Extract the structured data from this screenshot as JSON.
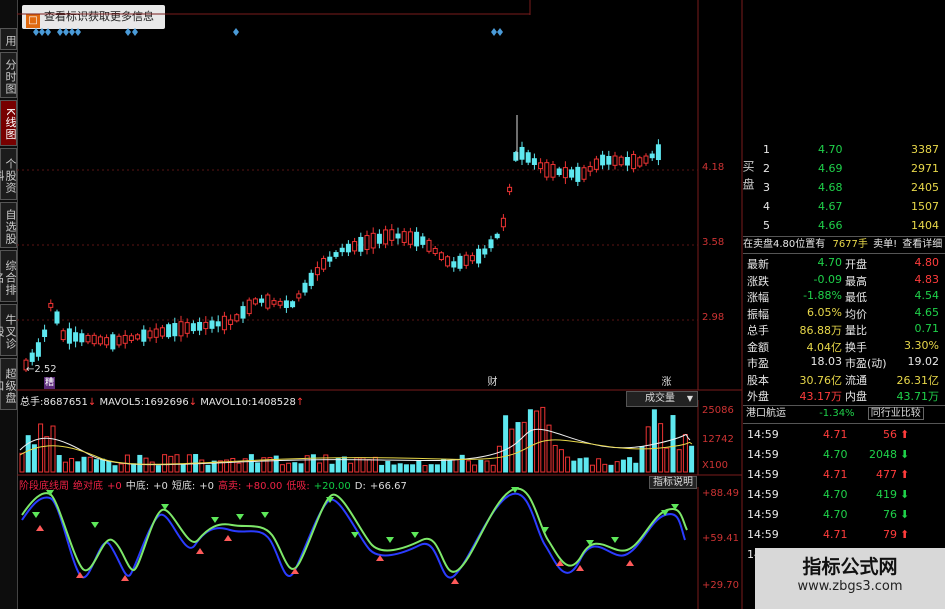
{
  "notice": {
    "icon": "window-icon",
    "text": "查看标识获取更多信息"
  },
  "sidebar": {
    "tabs": [
      "用",
      "分时图",
      "K线图",
      "个股资料",
      "自选股",
      "综合排名",
      "牛叉诊股",
      "超级盘口"
    ],
    "active": 2
  },
  "price_axis": {
    "labels": [
      "4.18",
      "3.58",
      "2.98"
    ],
    "low_marker": "2.52"
  },
  "markers": {
    "m1": "糟",
    "m2": "财",
    "m3": "涨"
  },
  "volume": {
    "header": {
      "total_label": "总手:",
      "total_value": "8687651",
      "mavol5_label": "MAVOL5:",
      "mavol5_value": "1692696",
      "mavol10_label": "MAVOL10:",
      "mavol10_value": "1408528"
    },
    "selector": "成交量",
    "axis": [
      "25086",
      "12742",
      "X100"
    ]
  },
  "indicator": {
    "header": [
      {
        "t": "阶段底线周",
        "c": "#e24"
      },
      {
        "t": "绝对底",
        "c": "#e24"
      },
      {
        "t": "+0",
        "c": "#e24"
      },
      {
        "t": "中底:",
        "c": "#ddd"
      },
      {
        "t": "+0",
        "c": "#ddd"
      },
      {
        "t": "短底:",
        "c": "#ddd"
      },
      {
        "t": "+0",
        "c": "#ddd"
      },
      {
        "t": "高卖:",
        "c": "#e24"
      },
      {
        "t": "+80.00",
        "c": "#e24"
      },
      {
        "t": "低吸:",
        "c": "#e24"
      },
      {
        "t": "+20.00",
        "c": "#1c4"
      },
      {
        "t": "D:",
        "c": "#ddd"
      },
      {
        "t": "+66.67",
        "c": "#ddd"
      }
    ],
    "button": "指标说明",
    "axis": [
      "+88.49",
      "+59.41",
      "+29.70"
    ]
  },
  "order_book": {
    "buy_label": "买盘",
    "rows": [
      {
        "lvl": "1",
        "price": "4.70",
        "vol": "3387"
      },
      {
        "lvl": "2",
        "price": "4.69",
        "vol": "2971"
      },
      {
        "lvl": "3",
        "price": "4.68",
        "vol": "2405"
      },
      {
        "lvl": "4",
        "price": "4.67",
        "vol": "1507"
      },
      {
        "lvl": "5",
        "price": "4.66",
        "vol": "1404"
      }
    ]
  },
  "sell_bar": {
    "text": "在卖盘4.80位置有",
    "vol": "7677手",
    "sell1": "卖单!",
    "detail": "查看详细"
  },
  "quote": [
    {
      "l": "最新",
      "v": "4.70",
      "vc": "green",
      "l2": "开盘",
      "v2": "4.80",
      "v2c": "red"
    },
    {
      "l": "涨跌",
      "v": "-0.09",
      "vc": "green",
      "l2": "最高",
      "v2": "4.83",
      "v2c": "red"
    },
    {
      "l": "涨幅",
      "v": "-1.88%",
      "vc": "green",
      "l2": "最低",
      "v2": "4.54",
      "v2c": "green"
    },
    {
      "l": "振幅",
      "v": "6.05%",
      "vc": "yellow",
      "l2": "均价",
      "v2": "4.65",
      "v2c": "green"
    },
    {
      "l": "总手",
      "v": "86.88万",
      "vc": "yellow",
      "l2": "量比",
      "v2": "0.71",
      "v2c": "green"
    },
    {
      "l": "金额",
      "v": "4.04亿",
      "vc": "yellow",
      "l2": "换手",
      "v2": "3.30%",
      "v2c": "yellow"
    },
    {
      "l": "市盈",
      "v": "18.03",
      "vc": "white",
      "l2": "市盈(动)",
      "v2": "19.02",
      "v2c": "white"
    },
    {
      "l": "股本",
      "v": "30.76亿",
      "vc": "yellow",
      "l2": "流通",
      "v2": "26.31亿",
      "v2c": "yellow"
    },
    {
      "l": "外盘",
      "v": "43.17万",
      "vc": "red",
      "l2": "内盘",
      "v2": "43.71万",
      "v2c": "green"
    }
  ],
  "sector": {
    "name": "港口航运",
    "change": "-1.34%",
    "compare": "同行业比较"
  },
  "ticks": [
    {
      "time": "14:59",
      "price": "4.71",
      "vol": "56",
      "dir": "up"
    },
    {
      "time": "14:59",
      "price": "4.70",
      "vol": "2048",
      "dir": "down"
    },
    {
      "time": "14:59",
      "price": "4.71",
      "vol": "477",
      "dir": "up"
    },
    {
      "time": "14:59",
      "price": "4.70",
      "vol": "419",
      "dir": "down"
    },
    {
      "time": "14:59",
      "price": "4.70",
      "vol": "76",
      "dir": "down"
    },
    {
      "time": "14:59",
      "price": "4.71",
      "vol": "79",
      "dir": "up"
    },
    {
      "time": "14:59",
      "price": "4.71",
      "vol": "115",
      "dir": "up"
    }
  ],
  "watermark": {
    "title": "指标公式网",
    "url": "www.zbgs3.com"
  }
}
